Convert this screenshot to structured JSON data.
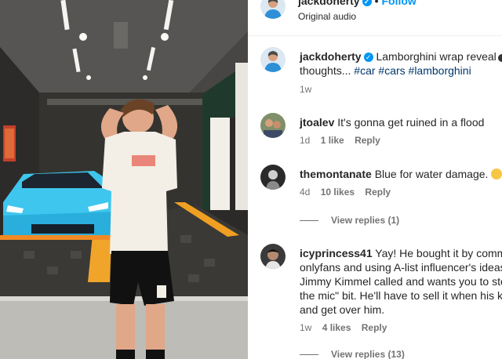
{
  "header": {
    "username": "jackdoherty",
    "follow_label": "Follow",
    "separator": "•",
    "audio_label": "Original audio"
  },
  "comments": [
    {
      "username": "jackdoherty",
      "text_line1": "Lamborghini wrap reveal",
      "text_line2": "thoughts...",
      "hashtags": [
        "#car",
        "#cars",
        "#lamborghini"
      ],
      "time": "1w",
      "verified": true
    },
    {
      "username": "jtoalev",
      "text": "It's gonna get ruined in a flood",
      "time": "1d",
      "likes": "1 like",
      "reply_label": "Reply"
    },
    {
      "username": "themontanate",
      "text": "Blue for water damage.",
      "time": "4d",
      "likes": "10 likes",
      "reply_label": "Reply",
      "view_replies": "View replies (1)"
    },
    {
      "username": "icyprincess41",
      "text_lines": [
        "Yay! He bought it by commi",
        "onlyfans and using A-list influencer's ideas",
        "Jimmy Kimmel called and wants you to sto",
        "the mic\" bit. He'll have to sell it when his k",
        "and get over him."
      ],
      "time": "1w",
      "likes": "4 likes",
      "reply_label": "Reply",
      "view_replies": "View replies (13)"
    }
  ],
  "colors": {
    "accent": "#0095f6",
    "hashtag": "#00376b",
    "meta": "#737373",
    "car": "#3fc6ee"
  },
  "icons": {
    "verified": "verified-badge-icon",
    "heart": "heart-icon"
  }
}
